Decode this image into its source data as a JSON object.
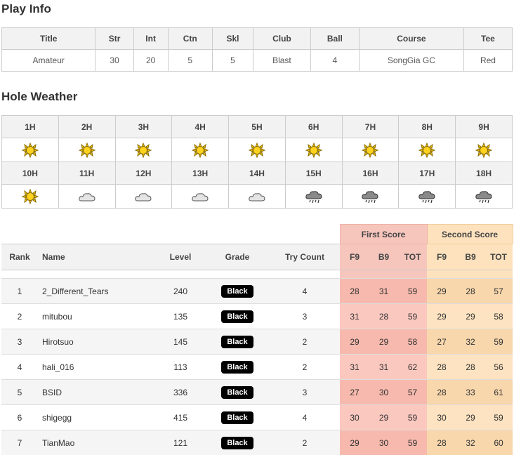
{
  "play_info": {
    "heading": "Play Info",
    "headers": [
      "Title",
      "Str",
      "Int",
      "Ctn",
      "Skl",
      "Club",
      "Ball",
      "Course",
      "Tee"
    ],
    "values": [
      "Amateur",
      "30",
      "20",
      "5",
      "5",
      "Blast",
      "4",
      "SongGia GC",
      "Red"
    ]
  },
  "hole_weather": {
    "heading": "Hole Weather",
    "rows": [
      {
        "holes": [
          "1H",
          "2H",
          "3H",
          "4H",
          "5H",
          "6H",
          "7H",
          "8H",
          "9H"
        ],
        "icons": [
          "sun-icon",
          "sun-icon",
          "sun-icon",
          "sun-icon",
          "sun-icon",
          "sun-icon",
          "sun-icon",
          "sun-icon",
          "sun-icon"
        ]
      },
      {
        "holes": [
          "10H",
          "11H",
          "12H",
          "13H",
          "14H",
          "15H",
          "16H",
          "17H",
          "18H"
        ],
        "icons": [
          "sun-icon",
          "cloud-icon",
          "cloud-icon",
          "cloud-icon",
          "cloud-icon",
          "rain-cloud-icon",
          "rain-cloud-icon",
          "rain-cloud-icon",
          "rain-cloud-icon"
        ]
      }
    ]
  },
  "ranking": {
    "group_first": "First Score",
    "group_second": "Second Score",
    "headers": {
      "rank": "Rank",
      "name": "Name",
      "level": "Level",
      "grade": "Grade",
      "try_count": "Try Count",
      "f_f9": "F9",
      "f_b9": "B9",
      "f_tot": "TOT",
      "s_f9": "F9",
      "s_b9": "B9",
      "s_tot": "TOT"
    },
    "rows": [
      {
        "rank": "1",
        "name": "2_Different_Tears",
        "level": "240",
        "grade": "Black",
        "try": "4",
        "f9": "28",
        "b9": "31",
        "tot": "59",
        "s9": "29",
        "sb9": "28",
        "stot": "57"
      },
      {
        "rank": "2",
        "name": "mitubou",
        "level": "135",
        "grade": "Black",
        "try": "3",
        "f9": "31",
        "b9": "28",
        "tot": "59",
        "s9": "29",
        "sb9": "29",
        "stot": "58"
      },
      {
        "rank": "3",
        "name": "Hirotsuo",
        "level": "145",
        "grade": "Black",
        "try": "2",
        "f9": "29",
        "b9": "29",
        "tot": "58",
        "s9": "27",
        "sb9": "32",
        "stot": "59"
      },
      {
        "rank": "4",
        "name": "hali_016",
        "level": "113",
        "grade": "Black",
        "try": "2",
        "f9": "31",
        "b9": "31",
        "tot": "62",
        "s9": "28",
        "sb9": "28",
        "stot": "56"
      },
      {
        "rank": "5",
        "name": "BSID",
        "level": "336",
        "grade": "Black",
        "try": "3",
        "f9": "27",
        "b9": "30",
        "tot": "57",
        "s9": "28",
        "sb9": "33",
        "stot": "61"
      },
      {
        "rank": "6",
        "name": "shigegg",
        "level": "415",
        "grade": "Black",
        "try": "4",
        "f9": "30",
        "b9": "29",
        "tot": "59",
        "s9": "30",
        "sb9": "29",
        "stot": "59"
      },
      {
        "rank": "7",
        "name": "TianMao",
        "level": "121",
        "grade": "Black",
        "try": "2",
        "f9": "29",
        "b9": "30",
        "tot": "59",
        "s9": "28",
        "sb9": "32",
        "stot": "60"
      }
    ]
  }
}
